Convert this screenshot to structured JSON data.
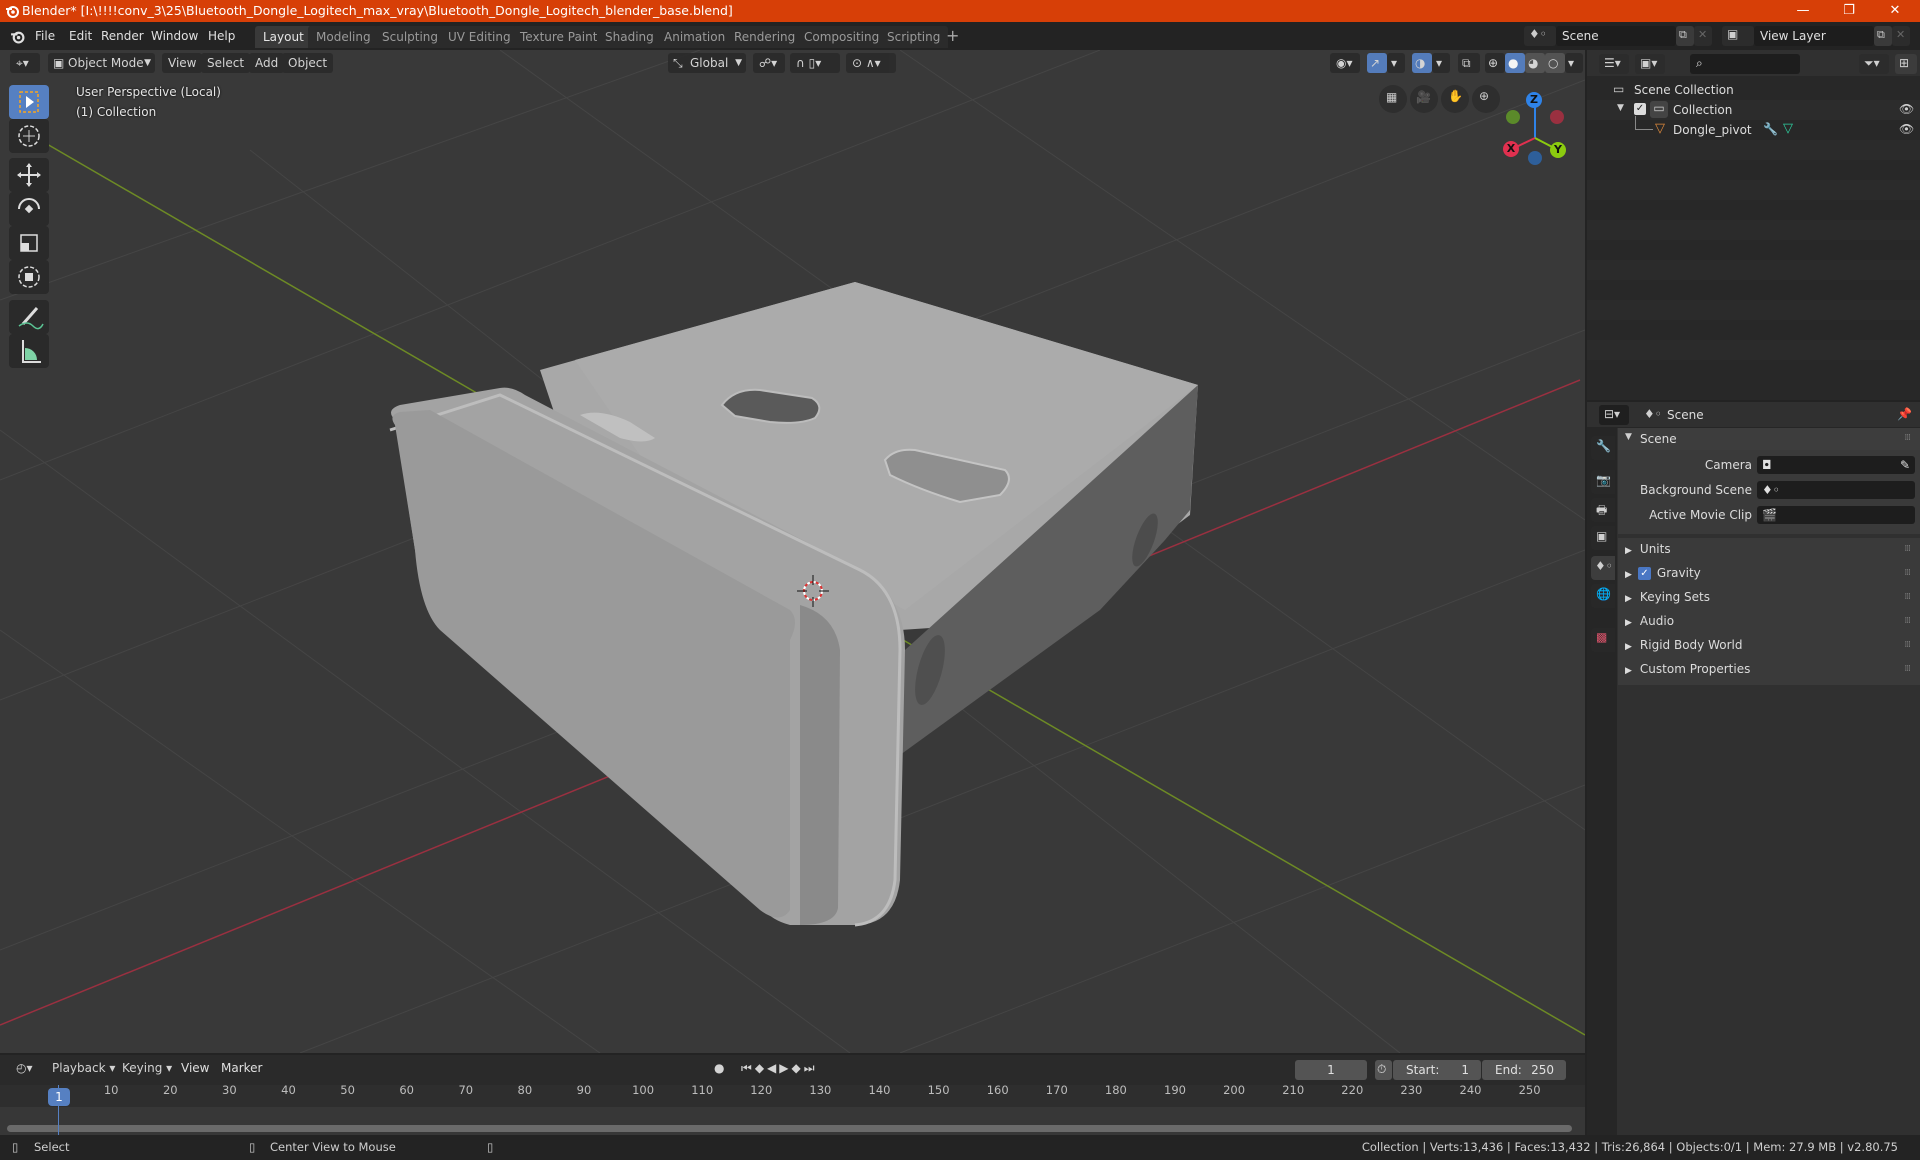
{
  "window": {
    "title": "Blender* [I:\\!!!!conv_3\\25\\Bluetooth_Dongle_Logitech_max_vray\\Bluetooth_Dongle_Logitech_blender_base.blend]",
    "controls": {
      "minimize": "—",
      "maximize": "❐",
      "close": "✕"
    }
  },
  "menubar": {
    "items": [
      "File",
      "Edit",
      "Render",
      "Window",
      "Help"
    ],
    "workspaces": [
      "Layout",
      "Modeling",
      "Sculpting",
      "UV Editing",
      "Texture Paint",
      "Shading",
      "Animation",
      "Rendering",
      "Compositing",
      "Scripting"
    ],
    "active_workspace": "Layout",
    "add_workspace": "+",
    "scene": "Scene",
    "view_layer": "View Layer"
  },
  "viewport": {
    "mode": "Object Mode",
    "menus": [
      "View",
      "Select",
      "Add",
      "Object"
    ],
    "transform_orientation": "Global",
    "perspective_label": "User Perspective (Local)",
    "collection_label": "(1) Collection",
    "gizmo": {
      "x": "X",
      "y": "Y",
      "z": "Z"
    },
    "colors": {
      "x_axis": "#b3364a",
      "y_axis": "#8bb32d",
      "z_axis": "#2f83e8",
      "background": "#393939",
      "grid": "#474747",
      "model": "#9c9c9c"
    }
  },
  "outliner": {
    "root": "Scene Collection",
    "items": [
      {
        "name": "Collection",
        "type": "collection",
        "visible": true,
        "checked": true
      },
      {
        "name": "Dongle_pivot",
        "type": "mesh-object",
        "visible": true
      }
    ]
  },
  "properties": {
    "context": "Scene",
    "section": "Scene",
    "fields": [
      {
        "label": "Camera",
        "value": ""
      },
      {
        "label": "Background Scene",
        "value": ""
      },
      {
        "label": "Active Movie Clip",
        "value": ""
      }
    ],
    "panels": [
      {
        "label": "Units"
      },
      {
        "label": "Gravity",
        "checkbox": true
      },
      {
        "label": "Keying Sets"
      },
      {
        "label": "Audio"
      },
      {
        "label": "Rigid Body World"
      },
      {
        "label": "Custom Properties"
      }
    ]
  },
  "timeline": {
    "menus": [
      "Playback",
      "Keying",
      "View",
      "Marker"
    ],
    "current_frame": "1",
    "start_label": "Start:",
    "start": "1",
    "end_label": "End:",
    "end": "250",
    "ticks": [
      "10",
      "20",
      "30",
      "40",
      "50",
      "60",
      "70",
      "80",
      "90",
      "100",
      "110",
      "120",
      "130",
      "140",
      "150",
      "160",
      "170",
      "180",
      "190",
      "200",
      "210",
      "220",
      "230",
      "240",
      "250"
    ],
    "frame_badge": "1"
  },
  "statusbar": {
    "left_action": "Select",
    "middle_action": "Center View to Mouse",
    "stats": "Collection | Verts:13,436 | Faces:13,432 | Tris:26,864 | Objects:0/1 | Mem: 27.9 MB | v2.80.75"
  }
}
